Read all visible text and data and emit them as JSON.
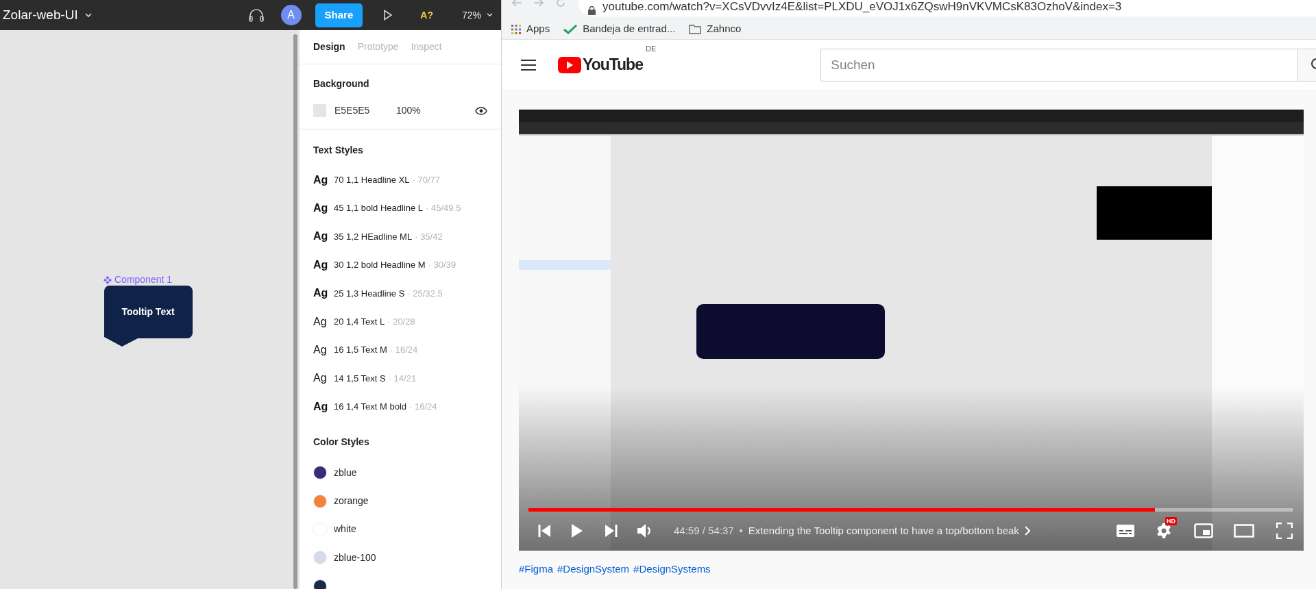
{
  "figma": {
    "file_name": "Zolar-web-UI",
    "avatar": "A",
    "share": "Share",
    "font_warning": "A?",
    "zoom": "72%",
    "canvas": {
      "component_label": "Component 1",
      "tooltip_text": "Tooltip Text"
    },
    "panel": {
      "tabs": [
        {
          "label": "Design",
          "selected": true
        },
        {
          "label": "Prototype",
          "selected": false
        },
        {
          "label": "Inspect",
          "selected": false
        }
      ],
      "background": {
        "heading": "Background",
        "hex": "E5E5E5",
        "opacity": "100%"
      },
      "text_styles": {
        "heading": "Text Styles",
        "items": [
          {
            "sample": "Ag",
            "bold": true,
            "name": "70 1,1 Headline XL",
            "size": "· 70/77"
          },
          {
            "sample": "Ag",
            "bold": true,
            "name": "45 1,1 bold Headline L",
            "size": "· 45/49.5"
          },
          {
            "sample": "Ag",
            "bold": true,
            "name": "35 1,2 HEadline ML",
            "size": "· 35/42"
          },
          {
            "sample": "Ag",
            "bold": true,
            "name": "30 1,2 bold Headline M",
            "size": "· 30/39"
          },
          {
            "sample": "Ag",
            "bold": true,
            "name": "25 1,3 Headline S",
            "size": "· 25/32.5"
          },
          {
            "sample": "Ag",
            "bold": false,
            "name": "20 1,4 Text L",
            "size": "· 20/28"
          },
          {
            "sample": "Ag",
            "bold": false,
            "name": "16 1,5 Text M",
            "size": "· 16/24"
          },
          {
            "sample": "Ag",
            "bold": false,
            "name": "14 1,5 Text S",
            "size": "· 14/21"
          },
          {
            "sample": "Ag",
            "bold": true,
            "name": "16 1,4 Text M bold",
            "size": "· 16/24"
          }
        ]
      },
      "color_styles": {
        "heading": "Color Styles",
        "items": [
          {
            "name": "zblue",
            "color": "#3b2a78"
          },
          {
            "name": "zorange",
            "color": "#f5813f"
          },
          {
            "name": "white",
            "color": "#ffffff"
          },
          {
            "name": "zblue-100",
            "color": "#d3dce5"
          },
          {
            "color": "#1b2b45"
          }
        ]
      }
    }
  },
  "browser": {
    "url": "youtube.com/watch?v=XCsVDvvIz4E&list=PLXDU_eVOJ1x6ZQswH9nVKVMCsK83OzhoV&index=3",
    "bookmarks": [
      {
        "kind": "apps",
        "label": "Apps"
      },
      {
        "kind": "check",
        "label": "Bandeja de entrad..."
      },
      {
        "kind": "folder",
        "label": "Zahnco"
      }
    ]
  },
  "youtube": {
    "logo": "YouTube",
    "region": "DE",
    "search_placeholder": "Suchen",
    "player": {
      "progress": {
        "level": 0.82
      },
      "time": "44:59 / 54:37",
      "separator": "•",
      "chapter": "Extending the Tooltip component to have a top/bottom beak",
      "quality_badge": "HD"
    },
    "hashtags": [
      "#Figma",
      "#DesignSystem",
      "#DesignSystems"
    ]
  }
}
